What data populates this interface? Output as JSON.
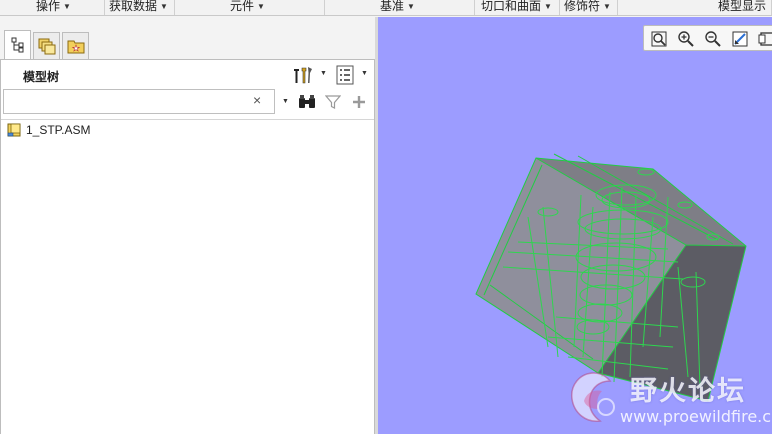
{
  "menubar": {
    "items": [
      {
        "label": "操作"
      },
      {
        "label": "获取数据"
      },
      {
        "label": "元件"
      },
      {
        "label": "基准"
      },
      {
        "label": "切口和曲面"
      },
      {
        "label": "修饰符"
      },
      {
        "label": "模型显示"
      }
    ]
  },
  "left_panel": {
    "tabs": [
      {
        "icon": "model-tree-icon",
        "active": true
      },
      {
        "icon": "layers-icon",
        "active": false
      },
      {
        "icon": "favorites-folder-icon",
        "active": false
      }
    ],
    "title": "模型树",
    "search": {
      "value": "",
      "placeholder": ""
    },
    "clear_symbol": "×",
    "tree_items": [
      {
        "label": "1_STP.ASM",
        "icon": "assembly-icon"
      }
    ]
  },
  "viewport": {
    "background": "#9c9cff",
    "wireframe_color": "#22cc44",
    "toolbar_icons": [
      "refit-icon",
      "zoom-in-icon",
      "zoom-out-icon",
      "repaint-icon",
      "saved-views-icon"
    ]
  },
  "watermark": {
    "title": "野火论坛",
    "url": "www.proewildfire.cn"
  }
}
